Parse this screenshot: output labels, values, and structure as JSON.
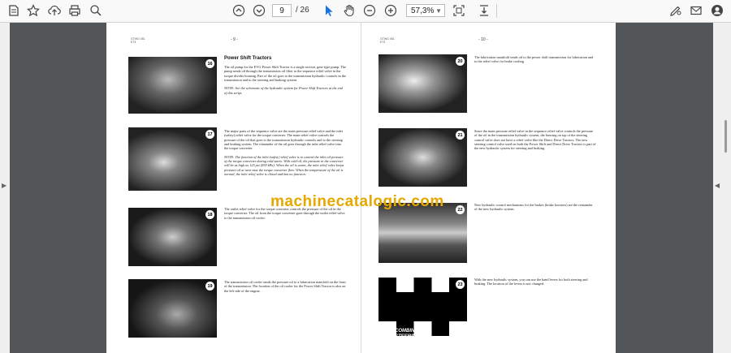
{
  "toolbar": {
    "page_current": "9",
    "page_total": "/ 26",
    "zoom": "57,3%",
    "icons": [
      "star-icon",
      "upload-icon",
      "print-icon",
      "zoom-search-icon",
      "page-up-icon",
      "page-down-icon",
      "select-cursor-icon",
      "hand-tool-icon",
      "zoom-out-icon",
      "zoom-in-icon",
      "fit-page-icon",
      "scroll-mode-icon",
      "sign-icon",
      "email-icon",
      "account-icon"
    ],
    "accent": "#1473e6"
  },
  "document": {
    "left_page": {
      "header_code": "GTWG 051\nE73",
      "page_num": "- 9 -",
      "section_title": "Power Shift Tractors",
      "items": [
        {
          "num": "16",
          "text": "The oil pump for the EVG Power Shift Tractor is a single section, gear-type pump. The pump sends oil through the transmission oil filter to the sequence relief valve in the torque divider housing. Part of the oil goes to the transmission hydraulic controls in the transmission and to the steering and braking system.",
          "note": "NOTE: See the schematic of the hydraulic system for Power Shift Tractors at the end of this script."
        },
        {
          "num": "17",
          "text": "The major parts of the sequence valve are the main pressure relief valve and the inlet (safety) relief valve for the torque converter. The main relief valve controls the pressure of the oil that goes to the transmission hydraulic controls and to the steering and braking system. The remainder of the oil goes through the inlet relief valve into the torque converter.",
          "note": "NOTE: The function of the inlet (safety) relief valve is to control the inlet oil pressure of the torque converter during cold starts. With cold oil, the pressure in the converter will be as high as 125 psi (830 kPa). When the oil is warm, the inlet relief valve keeps pressure oil at near max the torque converter flow. When the temperature of the oil is normal, the inlet relief valve is closed and has no function."
        },
        {
          "num": "18",
          "text": "The outlet relief valve for the torque converter controls the pressure of the oil in the torque converter. The oil from the torque converter goes through the outlet relief valve to the transmission oil cooler.",
          "note": ""
        },
        {
          "num": "19",
          "text": "The transmission oil cooler sends the pressure oil to a lubrication manifold on the front of the transmission. The location of the oil cooler for the Power Shift Tractor is also on the left side of the engine.",
          "note": ""
        }
      ]
    },
    "right_page": {
      "header_code": "GTWG 051\nE73",
      "page_num": "- 10 -",
      "items": [
        {
          "num": "20",
          "text": "The lubrication manifold sends oil to the power shift transmission for lubrication and to the relief valve for brake cooling.",
          "note": ""
        },
        {
          "num": "21",
          "text": "Since the main pressure relief valve in the sequence relief valve controls the pressure of the oil in the transmission hydraulic system, the housing on top of the steering control valve does not have a relief valve like the Direct Drive Tractors. The new steering control valve used on both the Power Shift and Direct Drive Tractors is part of the new hydraulic system for steering and braking.",
          "note": ""
        },
        {
          "num": "22",
          "text": "New hydraulic control mechanisms for the brakes (brake boosters) are the remainder of the new hydraulic system.",
          "note": ""
        },
        {
          "num": "23",
          "text": "With the new hydraulic system, you can use the hand levers for both steering and braking. The location of the levers is not changed.",
          "note": "",
          "slide_text": "COMBINED\nSTEERING\n& BRAKING"
        }
      ]
    },
    "watermark": "machinecatalogic.com"
  }
}
